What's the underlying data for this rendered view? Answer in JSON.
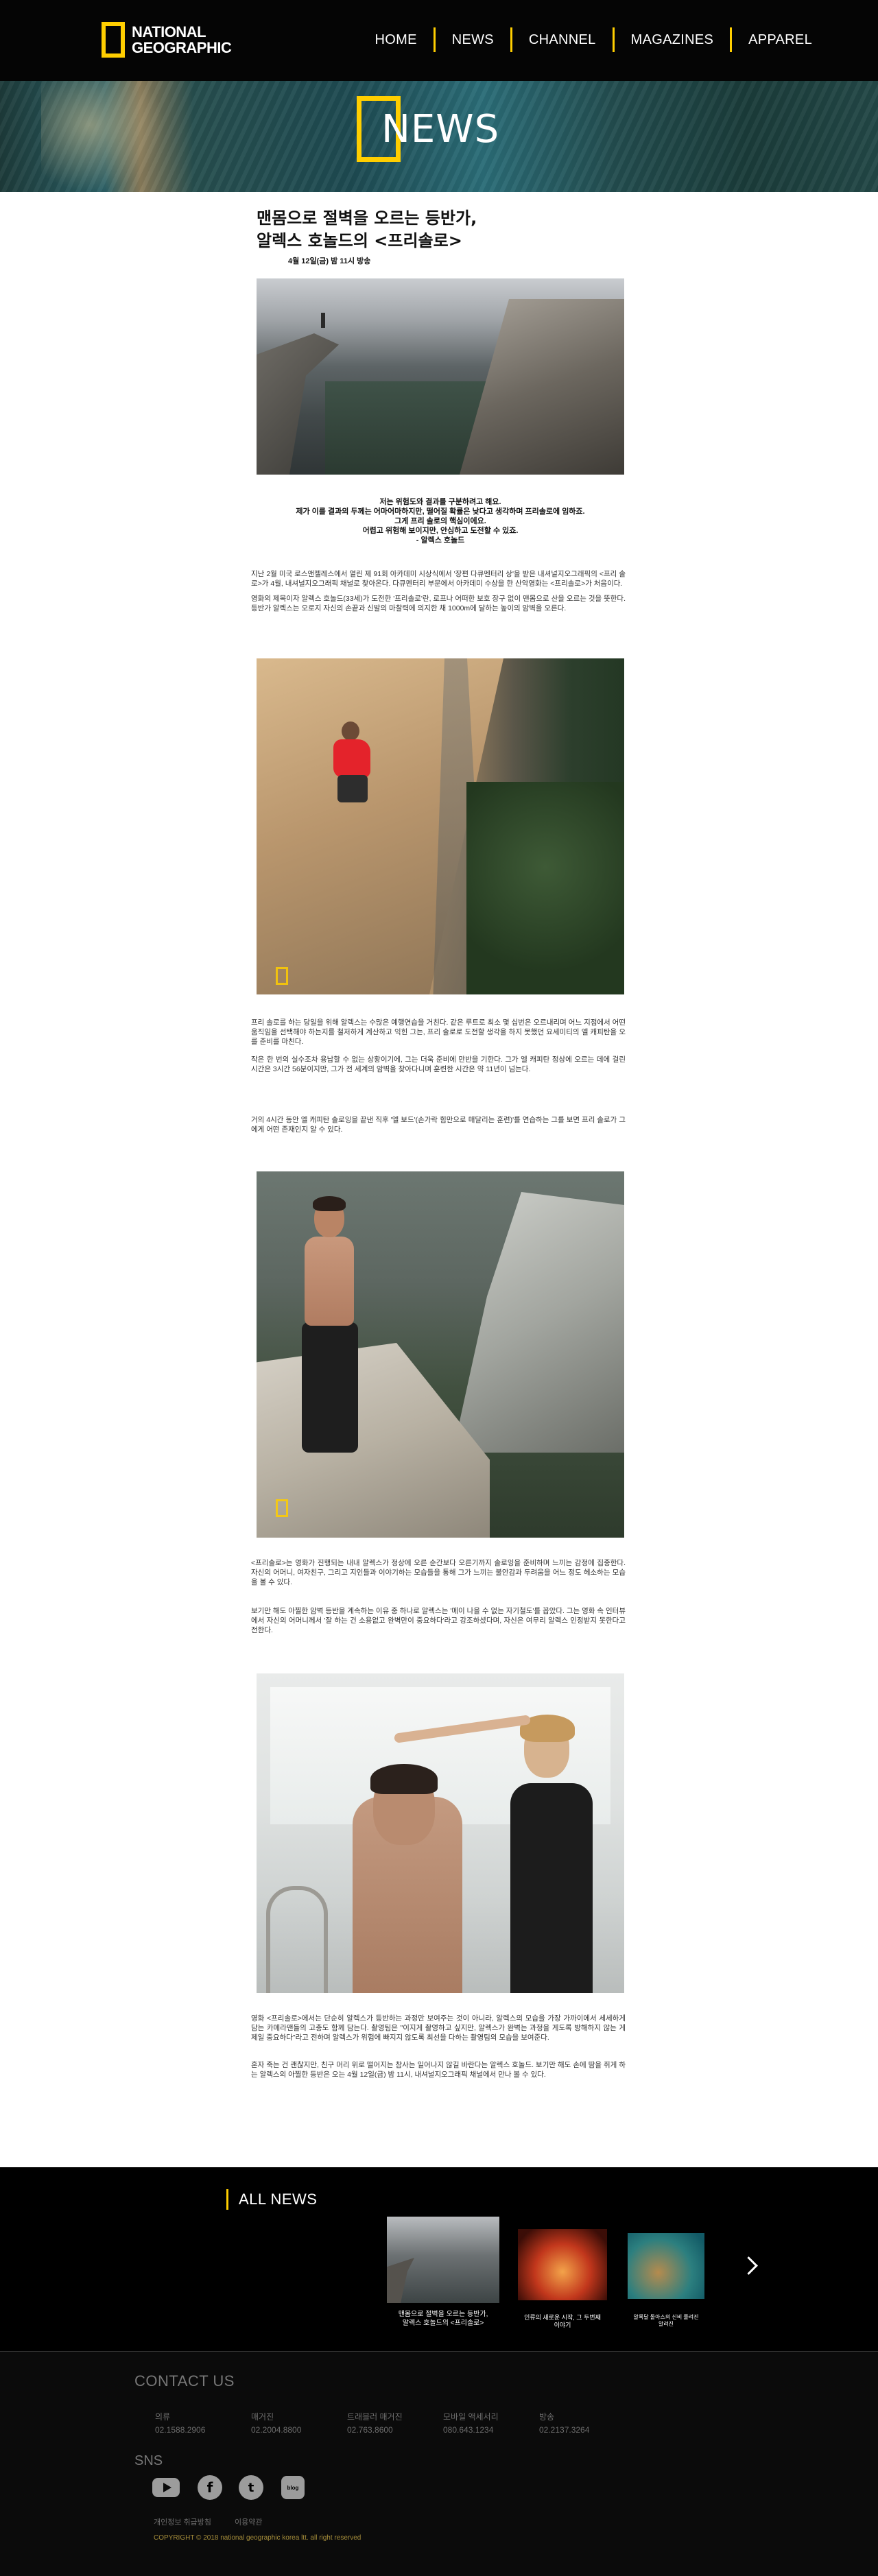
{
  "header": {
    "logo_line1": "NATIONAL",
    "logo_line2": "GEOGRAPHIC",
    "nav": [
      "HOME",
      "NEWS",
      "CHANNEL",
      "MAGAZINES",
      "APPAREL"
    ]
  },
  "banner": {
    "title": "NEWS"
  },
  "article": {
    "title_line1": "맨몸으로 절벽을 오르는 등반가,",
    "title_line2": "알렉스 호놀드의 <프리솔로>",
    "broadcast": "4월 12일(금) 밤 11시 방송",
    "quote": [
      "저는 위험도와 결과를 구분하려고 해요.",
      "제가 이를 결과의 두께는 어마어마하지만, 떨어질 확률은 낮다고 생각하며 프리솔로에 임하죠.",
      "그게 프리 솔로의 핵심이에요.",
      "어렵고 위험해 보이지만, 안심하고 도전할 수 있죠.",
      "- 알렉스 호놀드"
    ],
    "para1": "지난 2월 미국 로스앤젤레스에서 열린 제 91회 아카데미 시상식에서 '장편 다큐멘터리 상'을 받은 내셔널지오그래픽의 <프리 솔로>가 4월, 내셔널지오그래픽 채널로 찾아온다. 다큐멘터리 부문에서 아카데미 수상을 한 산악영화는 <프리솔로>가 처음이다.",
    "para2": "영화의 제목이자 알렉스 호놀드(33세)가 도전한 '프리솔로'란, 로프나 어떠한 보호 장구 없이 맨몸으로 산을 오르는 것을 뜻한다. 등반가 알렉스는 오로지 자신의 손끝과 신발의 마찰력에 의지한 채 1000m에 달하는 높이의 암벽을 오른다.",
    "para3": "프리 솔로를 하는 당일을 위해 알렉스는 수많은 예행연습을 거친다. 같은 루트로 최소 몇 십번은 오르내리며 어느 지점에서 어떤 움직임을 선택해야 하는지를 철저하게 계산하고 익힌 그는, 프리 솔로로 도전할 생각을 하지 못했던 요세미티의 엘 캐피탄을 오를 준비를 마친다.",
    "para4": "작은 한 번의 실수조차 용납할 수 없는 상황이기에, 그는 더욱 준비에 만반을 기한다. 그가 엘 캐피탄 정상에 오르는 데에 걸린 시간은 3시간 56분이지만, 그가 전 세계의 암벽을 찾아다니며 훈련한 시간은 약 11년이 넘는다.",
    "para5": "거의 4시간 동안 엘 캐피탄 솔로잉을 끝낸 직후 '엘 보드'(손가락 힘만으로 매달리는 훈련)'를 연습하는 그를 보면 프리 솔로가 그에게 어떤 존재인지 알 수 있다.",
    "para6": "<프리솔로>는 영화가 진행되는 내내 알렉스가 정상에 오른 순간보다 오른기까지 솔로잉을 준비하며 느끼는 감정에 집중한다. 자신의 어머니, 여자친구, 그리고 지인들과 이야기하는 모습들을 통해 그가 느끼는 불안감과 두려움을 어느 정도 헤소하는 모습을 볼 수 있다.",
    "para7": "보기만 해도 아찔한 암벽 등반을 계속하는 이유 중 하나로 알렉스는 '메이 나을 수 없는 자기철도'를 꼽았다. 그는 영화 속 인터뷰에서 자신의 어머니께서 '잘 하는 건 소용없고 완벽만이 중요하다'라고 강조하셨다며, 자신은 여무리 알렉스 인정받지 못한다고 전한다.",
    "para8": "영화 <프리솔로>에서는 단순히 알렉스가 등반하는 과정만 보여주는 것이 아니라, 알렉스의 모습을 가장 가까이에서 세세하게 담는 카메라맨들의 고충도 함께 담는다. 촬영팀은 \"이지게 촬영하고 싶지만, 알렉스가 완벽는 과정을 게도록 방해하지 않는 게 제일 중요하다\"라고 전하며 알렉스가 위험에 빠지지 않도록 최선을 다하는 촬영팀의 모습을 보여준다.",
    "para9": "혼자 죽는 건 괜찮지만, 친구 머리 위로 떨어지는 참사는 일어나지 않길 바란다는 알렉스 호놀드. 보기만 해도 손에 땀을 쥐게 하는 알렉스의 아찔한 등반은 오는 4월 12일(금) 밤 11시, 내셔널지오그래픽 채널에서 만나 볼 수 있다."
  },
  "all_news": {
    "title": "ALL NEWS",
    "items": [
      {
        "caption_line1": "맨몸으로 절벽을 오르는 등반가,",
        "caption_line2": "알렉스 호놀드의 <프리솔로>"
      },
      {
        "caption_line1": "인류의 새로운 시작, 그 두번째",
        "caption_line2": "이야기"
      },
      {
        "caption_line1": "알록달 돌아스의 신비 풀려진",
        "caption_line2": "알려진"
      }
    ]
  },
  "footer": {
    "contact_title": "CONTACT US",
    "contacts": [
      {
        "label": "의류",
        "phone": "02.1588.2906"
      },
      {
        "label": "매거진",
        "phone": "02.2004.8800"
      },
      {
        "label": "트래블러 매거진",
        "phone": "02.763.8600"
      },
      {
        "label": "모바일 액세서리",
        "phone": "080.643.1234"
      },
      {
        "label": "방송",
        "phone": "02.2137.3264"
      }
    ],
    "sns_title": "SNS",
    "sns_fb": "f",
    "sns_tw": "t",
    "sns_bl": "blog",
    "links": [
      "개인정보 취급방침",
      "이용약관"
    ],
    "copyright": "COPYRIGHT © 2018 national geographic korea ltt.  all right reserved"
  }
}
